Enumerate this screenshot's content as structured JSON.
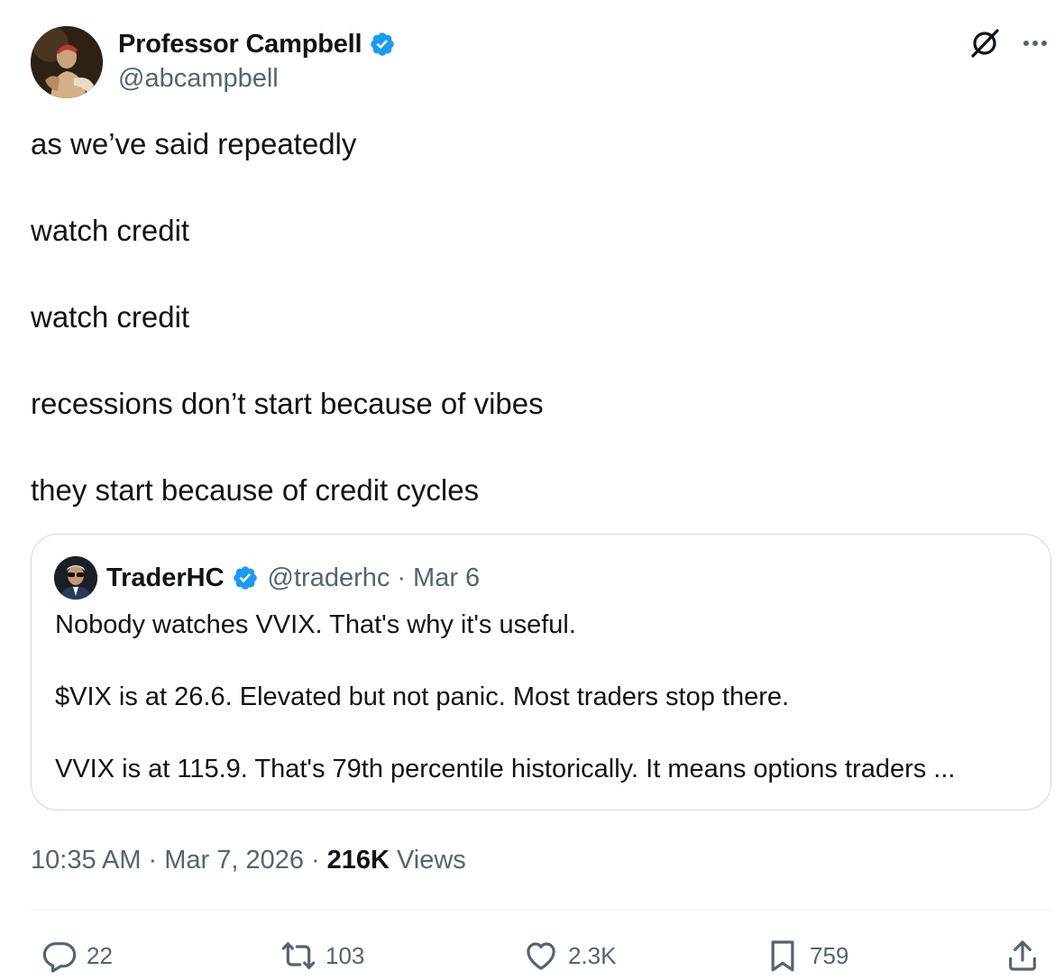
{
  "author": {
    "name": "Professor Campbell",
    "handle": "@abcampbell",
    "verified": true
  },
  "tweet": {
    "lines": [
      "as we’ve said repeatedly",
      "watch credit",
      "watch credit",
      "recessions don’t start because of vibes",
      "they start because of credit cycles"
    ]
  },
  "quote": {
    "name": "TraderHC",
    "handle": "@traderhc",
    "separator": "·",
    "date": "Mar 6",
    "lines": [
      "Nobody watches VVIX. That's why it's useful.",
      "$VIX is at 26.6. Elevated but not panic. Most traders stop there.",
      "VVIX is at 115.9. That's 79th percentile historically. It means options traders ..."
    ]
  },
  "meta": {
    "time": "10:35 AM",
    "separator": "·",
    "date": "Mar 7, 2026",
    "views_count": "216K",
    "views_label": "Views"
  },
  "actions": {
    "reply": "22",
    "repost": "103",
    "like": "2.3K",
    "bookmark": "759"
  },
  "icons": {
    "verified": "verified-badge-icon",
    "grok": "grok-icon",
    "more": "more-icon",
    "reply": "reply-icon",
    "repost": "repost-icon",
    "like": "heart-icon",
    "bookmark": "bookmark-icon",
    "share": "share-icon"
  },
  "colors": {
    "text": "#0f1419",
    "secondary": "#536471",
    "verified": "#1d9bf0",
    "border": "#cfd9de"
  }
}
